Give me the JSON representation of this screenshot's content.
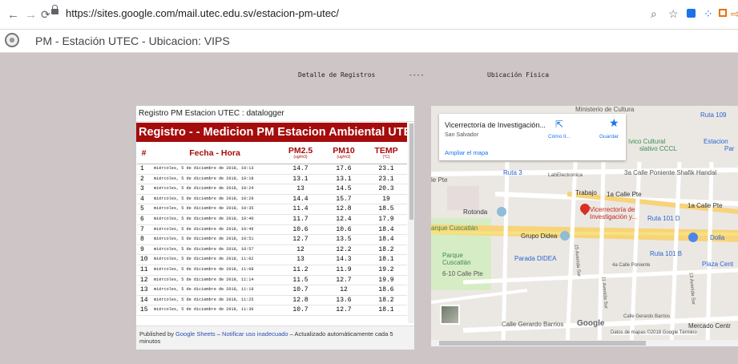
{
  "browser": {
    "url": "https://sites.google.com/mail.utec.edu.sv/estacion-pm-utec/"
  },
  "site": {
    "title": "PM - Estación UTEC - Ubicacion: VIPS"
  },
  "details": {
    "left": "Detalle de Registros",
    "sep": "----",
    "right": "Ubicación Física"
  },
  "sheet": {
    "header": "Registro PM Estacion UTEC : datalogger",
    "banner": "Registro - - Medicion PM Estacion Ambiental UTEC",
    "columns": [
      {
        "label": "#",
        "unit": ""
      },
      {
        "label": "Fecha - Hora",
        "unit": ""
      },
      {
        "label": "PM2.5",
        "unit": "(ug/m3)"
      },
      {
        "label": "PM10",
        "unit": "(ug/m3)"
      },
      {
        "label": "TEMP",
        "unit": "(°C)"
      }
    ],
    "rows": [
      [
        "1",
        "miércoles, 5 de diciembre de 2018, 10:13",
        "14.7",
        "17.6",
        "23.1"
      ],
      [
        "2",
        "miércoles, 5 de diciembre de 2018, 10:18",
        "13.1",
        "13.1",
        "23.1"
      ],
      [
        "3",
        "miércoles, 5 de diciembre de 2018, 10:24",
        "13",
        "14.5",
        "20.3"
      ],
      [
        "4",
        "miércoles, 5 de diciembre de 2018, 10:29",
        "14.4",
        "15.7",
        "19"
      ],
      [
        "5",
        "miércoles, 5 de diciembre de 2018, 10:35",
        "11.4",
        "12.8",
        "18.5"
      ],
      [
        "6",
        "miércoles, 5 de diciembre de 2018, 10:40",
        "11.7",
        "12.4",
        "17.9"
      ],
      [
        "7",
        "miércoles, 5 de diciembre de 2018, 10:46",
        "10.6",
        "10.6",
        "18.4"
      ],
      [
        "8",
        "miércoles, 5 de diciembre de 2018, 10:51",
        "12.7",
        "13.5",
        "18.4"
      ],
      [
        "9",
        "miércoles, 5 de diciembre de 2018, 10:57",
        "12",
        "12.2",
        "18.2"
      ],
      [
        "10",
        "miércoles, 5 de diciembre de 2018, 11:02",
        "13",
        "14.3",
        "18.1"
      ],
      [
        "11",
        "miércoles, 5 de diciembre de 2018, 11:08",
        "11.2",
        "11.9",
        "19.2"
      ],
      [
        "12",
        "miércoles, 5 de diciembre de 2018, 11:14",
        "11.5",
        "12.7",
        "19.9"
      ],
      [
        "13",
        "miércoles, 5 de diciembre de 2018, 11:19",
        "10.7",
        "12",
        "18.6"
      ],
      [
        "14",
        "miércoles, 5 de diciembre de 2018, 11:25",
        "12.8",
        "13.6",
        "18.2"
      ],
      [
        "15",
        "miércoles, 5 de diciembre de 2018, 11:30",
        "10.7",
        "12.7",
        "18.1"
      ]
    ],
    "footer": {
      "pub_prefix": "Published by",
      "pub_link": "Google Sheets",
      "dash": "–",
      "report_link": "Notificar uso inadecuado",
      "auto": "– Actualizado automáticamente cada 5 minutos"
    }
  },
  "map": {
    "info": {
      "title": "Vicerrectoría de Investigación...",
      "subtitle": "San Salvador",
      "directions": "Cómo ll...",
      "save": "Guardar",
      "enlarge": "Ampliar el mapa"
    },
    "labels": {
      "ministerio": "Ministerio de Cultura",
      "ruta109": "Ruta 109",
      "civico": "ívico Cultural",
      "cccl": "slativo CCCL",
      "estacion": "Estacion",
      "par": "Par",
      "ruta3": "Ruta 3",
      "labelectronica": "LabElectronica",
      "sanmarcos": "3a Calle Poniente Shafik Handal",
      "pte": "le Pte",
      "trabajo": "Trabajo",
      "calle1a": "1a Calle Pte",
      "calle1a_b": "1a Calle Pte",
      "rotonda": "Rotonda",
      "vice": "Vicerrectoría de",
      "vice2": "Investigación y...",
      "ruta101d": "Ruta 101 D",
      "parque_cusc": "arque Cuscatlán",
      "didea": "Grupo Didea",
      "dolla": "Dolla",
      "parque": "Parque",
      "cuscatlan": "Cuscatlán",
      "parada": "Parada DIDEA",
      "ruta101b": "Ruta 101 B",
      "plaza": "Plaza Cent",
      "calle6": "6-10 Calle Pte",
      "calle4a": "4a Calle Poniente",
      "av15": "15 Avenida Sur",
      "av11": "11 Avenida Sur",
      "av13": "13 Avenida Sur",
      "gerardo": "Calle Gerardo Barrios",
      "gerardo2": "Calle Gerardo Barrios",
      "mercado": "Mercado Centr",
      "google": "Google",
      "copyright": "Datos de mapas ©2018 Google   Término"
    }
  },
  "colors": {
    "banner": "#a50c0c",
    "header_text": "#a50c0c",
    "link": "#2b4fb5",
    "page_bg": "#cec6c6"
  }
}
